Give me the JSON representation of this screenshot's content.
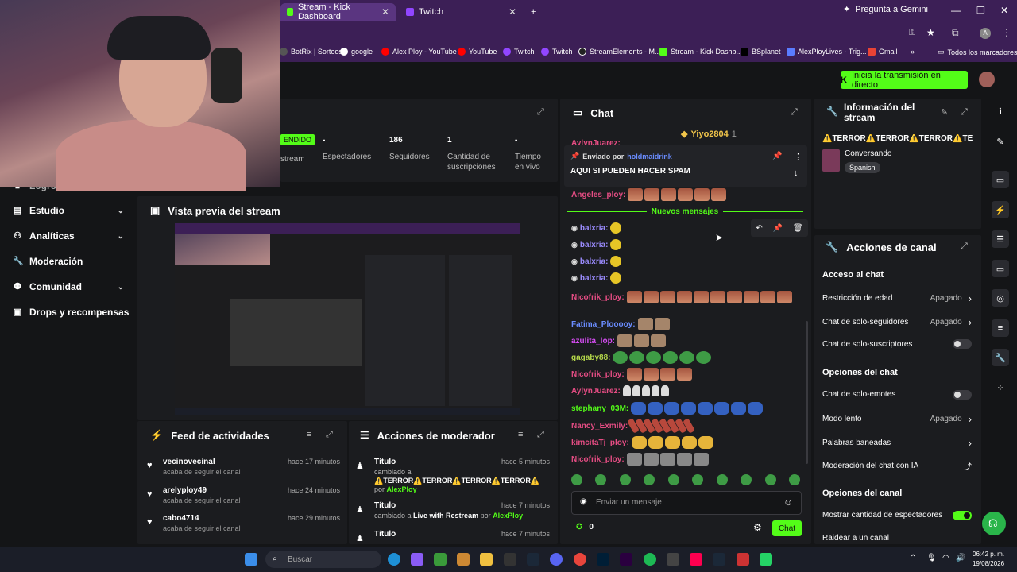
{
  "browser": {
    "tabs": [
      {
        "label": "Stream - Kick Dashboard",
        "active": true
      },
      {
        "label": "Twitch",
        "active": false
      }
    ],
    "new_tab": "+",
    "gemini": "Pregunta a Gemini",
    "bookmarks": [
      "BotRix | Sorteos",
      "google",
      "Alex Ploy - YouTube",
      "YouTube",
      "Twitch",
      "Twitch",
      "StreamElements - M...",
      "Stream - Kick Dashb...",
      "BSplanet",
      "AlexPloyLives - Trig...",
      "Gmail",
      "»",
      "Todos los marcadores"
    ]
  },
  "header": {
    "go_live": "Inicia la transmisión en directo"
  },
  "sidebar": {
    "items": [
      {
        "label": "Logros"
      },
      {
        "label": "Estudio",
        "chev": "⌄"
      },
      {
        "label": "Analíticas",
        "chev": "⌄"
      },
      {
        "label": "Moderación",
        "chev": ""
      },
      {
        "label": "Comunidad",
        "chev": "⌄"
      },
      {
        "label": "Drops y recompensas",
        "chev": ""
      }
    ]
  },
  "stats": {
    "live_badge": "ENDIDO",
    "stream_label": "stream",
    "items": [
      {
        "value": "-",
        "label": "Espectadores"
      },
      {
        "value": "186",
        "label": "Seguidores"
      },
      {
        "value": "1",
        "label": "Cantidad de suscripciones"
      },
      {
        "value": "-",
        "label": "Tiempo en vivo"
      }
    ]
  },
  "preview": {
    "title": "Vista previa del stream"
  },
  "feed": {
    "title": "Feed de actividades",
    "items": [
      {
        "name": "vecinovecinal",
        "action": "acaba de seguir el canal",
        "time": "hace 17 minutos"
      },
      {
        "name": "arelyploy49",
        "action": "acaba de seguir el canal",
        "time": "hace 24 minutos"
      },
      {
        "name": "cabo4714",
        "action": "acaba de seguir el canal",
        "time": "hace 29 minutos"
      }
    ]
  },
  "mod_actions": {
    "title": "Acciones de moderador",
    "items": [
      {
        "title": "Título",
        "time": "hace 5 minutos",
        "line1": "cambiado a",
        "line2": "⚠️TERROR⚠️TERROR⚠️TERROR⚠️TERROR⚠️",
        "by": "por",
        "user": "AlexPloy"
      },
      {
        "title": "Título",
        "time": "hace 7 minutos",
        "line1": "cambiado a",
        "line2": "Live with Restream",
        "by": "por",
        "user": "AlexPloy"
      },
      {
        "title": "Título",
        "time": "hace 7 minutos",
        "line1": "",
        "line2": "",
        "by": "",
        "user": ""
      }
    ]
  },
  "chat": {
    "title": "Chat",
    "top_gifter": "Yiyo2804",
    "top_gifter_count": "1",
    "cut_user": "AylynJuarez:",
    "pinned": {
      "sent_by": "Enviado por",
      "user": "holdmaidrink",
      "text": "AQUI SI PUEDEN HACER SPAM"
    },
    "new_messages": "Nuevos mensajes",
    "messages": [
      {
        "user": "Angeles_ploy:",
        "color": "#e64d84",
        "emote": "r",
        "count": 6
      },
      {
        "user": "balxria:",
        "color": "#9b8cff",
        "emote": "y",
        "count": 1,
        "badge": true
      },
      {
        "user": "balxria:",
        "color": "#9b8cff",
        "emote": "y",
        "count": 1,
        "badge": true
      },
      {
        "user": "balxria:",
        "color": "#9b8cff",
        "emote": "y",
        "count": 1,
        "badge": true
      },
      {
        "user": "balxria:",
        "color": "#9b8cff",
        "emote": "y",
        "count": 1,
        "badge": true
      },
      {
        "user": "Nicofrik_ploy:",
        "color": "#e64d84",
        "emote": "r",
        "count": 10
      },
      {
        "user": "Fatima_Plooooy:",
        "color": "#6a8cff",
        "emote": "cat",
        "count": 2
      },
      {
        "user": "azulita_lop:",
        "color": "#d54df2",
        "emote": "cat",
        "count": 3
      },
      {
        "user": "gagaby88:",
        "color": "#b5d84a",
        "emote": "g",
        "count": 6
      },
      {
        "user": "Nicofrik_ploy:",
        "color": "#e64d84",
        "emote": "r",
        "count": 4
      },
      {
        "user": "AylynJuarez:",
        "color": "#e64d84",
        "emote": "w",
        "count": 5
      },
      {
        "user": "stephany_03M:",
        "color": "#53fc18",
        "emote": "b",
        "count": 8
      },
      {
        "user": "Nancy_Exmily:",
        "color": "#e64d84",
        "emote": "s",
        "count": 8
      },
      {
        "user": "kimcitaTj_ploy:",
        "color": "#e64d84",
        "emote": "o",
        "count": 5
      },
      {
        "user": "Nicofrik_ploy:",
        "color": "#e64d84",
        "emote": "gr",
        "count": 5
      }
    ],
    "input_placeholder": "Enviar un mensaje",
    "points": "0",
    "send": "Chat"
  },
  "info": {
    "title_line1": "Información del",
    "title_line2": "stream",
    "stream_title": "⚠️TERROR⚠️TERROR⚠️TERROR⚠️TERR",
    "category": "Conversando",
    "language": "Spanish"
  },
  "channel_actions": {
    "title": "Acciones de canal",
    "sections": [
      {
        "heading": "Acceso al chat",
        "rows": [
          {
            "label": "Restricción de edad",
            "value": "Apagado",
            "kind": "arrow"
          },
          {
            "label": "Chat de solo-seguidores",
            "value": "Apagado",
            "kind": "arrow"
          },
          {
            "label": "Chat de solo-suscriptores",
            "value": "",
            "kind": "toggle-off"
          }
        ]
      },
      {
        "heading": "Opciones del chat",
        "rows": [
          {
            "label": "Chat de solo-emotes",
            "value": "",
            "kind": "toggle-off"
          },
          {
            "label": "Modo lento",
            "value": "Apagado",
            "kind": "arrow"
          },
          {
            "label": "Palabras baneadas",
            "value": "",
            "kind": "arrow"
          },
          {
            "label": "Moderación del chat con IA",
            "value": "",
            "kind": "external"
          }
        ]
      },
      {
        "heading": "Opciones del canal",
        "rows": [
          {
            "label": "Mostrar cantidad de espectadores",
            "value": "",
            "kind": "toggle-on"
          },
          {
            "label": "Raidear a un canal",
            "value": "",
            "kind": "none"
          }
        ]
      }
    ]
  },
  "taskbar": {
    "search": "Buscar",
    "time": "06:42 p. m.",
    "date": "19/08/2026"
  }
}
